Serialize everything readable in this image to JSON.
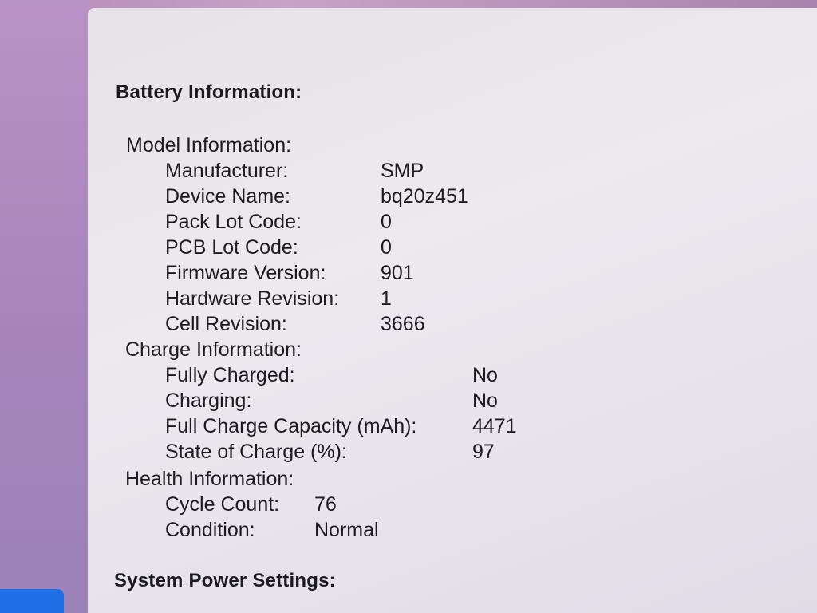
{
  "battery": {
    "heading": "Battery Information:",
    "model": {
      "heading": "Model Information:",
      "manufacturer": {
        "label": "Manufacturer:",
        "value": "SMP"
      },
      "device_name": {
        "label": "Device Name:",
        "value": "bq20z451"
      },
      "pack_lot_code": {
        "label": "Pack Lot Code:",
        "value": "0"
      },
      "pcb_lot_code": {
        "label": "PCB Lot Code:",
        "value": "0"
      },
      "firmware_version": {
        "label": "Firmware Version:",
        "value": "901"
      },
      "hardware_revision": {
        "label": "Hardware Revision:",
        "value": "1"
      },
      "cell_revision": {
        "label": "Cell Revision:",
        "value": "3666"
      }
    },
    "charge": {
      "heading": "Charge Information:",
      "fully_charged": {
        "label": "Fully Charged:",
        "value": "No"
      },
      "charging": {
        "label": "Charging:",
        "value": "No"
      },
      "full_charge_capacity": {
        "label": "Full Charge Capacity (mAh):",
        "value": "4471"
      },
      "state_of_charge": {
        "label": "State of Charge (%):",
        "value": "97"
      }
    },
    "health": {
      "heading": "Health Information:",
      "cycle_count": {
        "label": "Cycle Count:",
        "value": "76"
      },
      "condition": {
        "label": "Condition:",
        "value": "Normal"
      }
    }
  },
  "system_power": {
    "heading": "System Power Settings:"
  },
  "colors": {
    "sidebar": "#a684ba",
    "content_background": "#e8e5eb",
    "selection": "#1f6fe6",
    "text": "#1d1b22"
  }
}
